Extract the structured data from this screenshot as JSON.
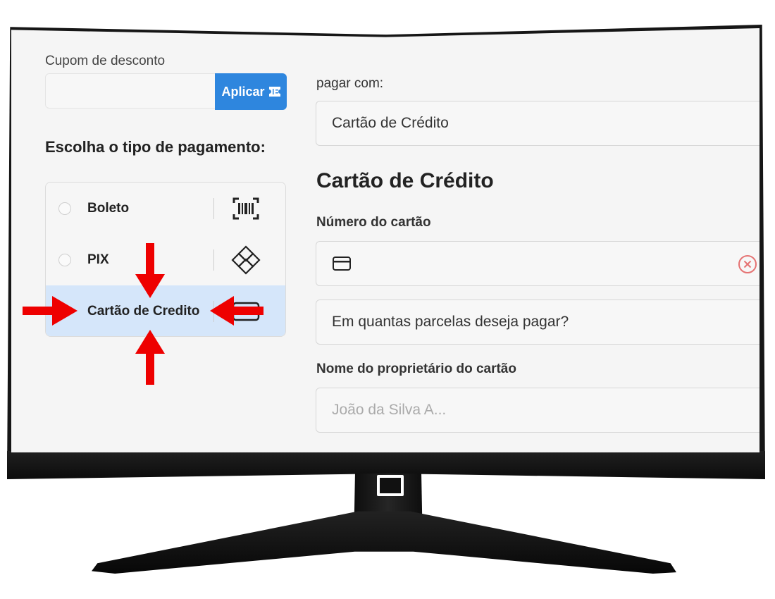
{
  "coupon": {
    "label": "Cupom de desconto",
    "value": "",
    "apply_label": "Aplicar"
  },
  "payment_types": {
    "title": "Escolha o tipo de pagamento:",
    "items": [
      {
        "label": "Boleto",
        "icon": "barcode-icon",
        "selected": false
      },
      {
        "label": "PIX",
        "icon": "pix-icon",
        "selected": false
      },
      {
        "label": "Cartão de Credito",
        "icon": "credit-card-icon",
        "selected": true
      }
    ]
  },
  "pay_with": {
    "label": "pagar com:",
    "selected": "Cartão de Crédito"
  },
  "card_form": {
    "title": "Cartão de Crédito",
    "number_label": "Número do cartão",
    "number_value": "",
    "installments_placeholder": "Em quantas parcelas deseja pagar?",
    "owner_label": "Nome do proprietário do cartão",
    "owner_placeholder": "João da Silva A..."
  },
  "colors": {
    "accent": "#2e86de",
    "selected_bg": "#d5e6fa",
    "annotation_arrow": "#ee0000",
    "error_icon": "#e57373"
  }
}
